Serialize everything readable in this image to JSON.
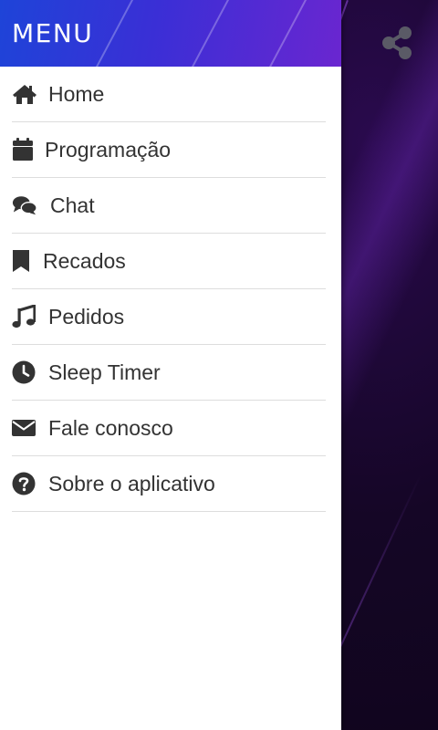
{
  "drawer": {
    "title": "MENU",
    "items": [
      {
        "label": "Home",
        "icon": "home-icon"
      },
      {
        "label": "Programação",
        "icon": "calendar-icon"
      },
      {
        "label": "Chat",
        "icon": "chat-icon"
      },
      {
        "label": "Recados",
        "icon": "bookmark-icon"
      },
      {
        "label": "Pedidos",
        "icon": "music-icon"
      },
      {
        "label": "Sleep Timer",
        "icon": "clock-icon"
      },
      {
        "label": "Fale conosco",
        "icon": "envelope-icon"
      },
      {
        "label": "Sobre o aplicativo",
        "icon": "question-circle-icon"
      }
    ]
  },
  "toolbar": {
    "share_icon": "share-icon"
  },
  "colors": {
    "header_start": "#1e44d8",
    "header_end": "#6a26d0",
    "icon_and_text": "#333333",
    "divider": "#dddddd",
    "background_dark": "#12061f",
    "share_icon": "#5a5a66"
  }
}
